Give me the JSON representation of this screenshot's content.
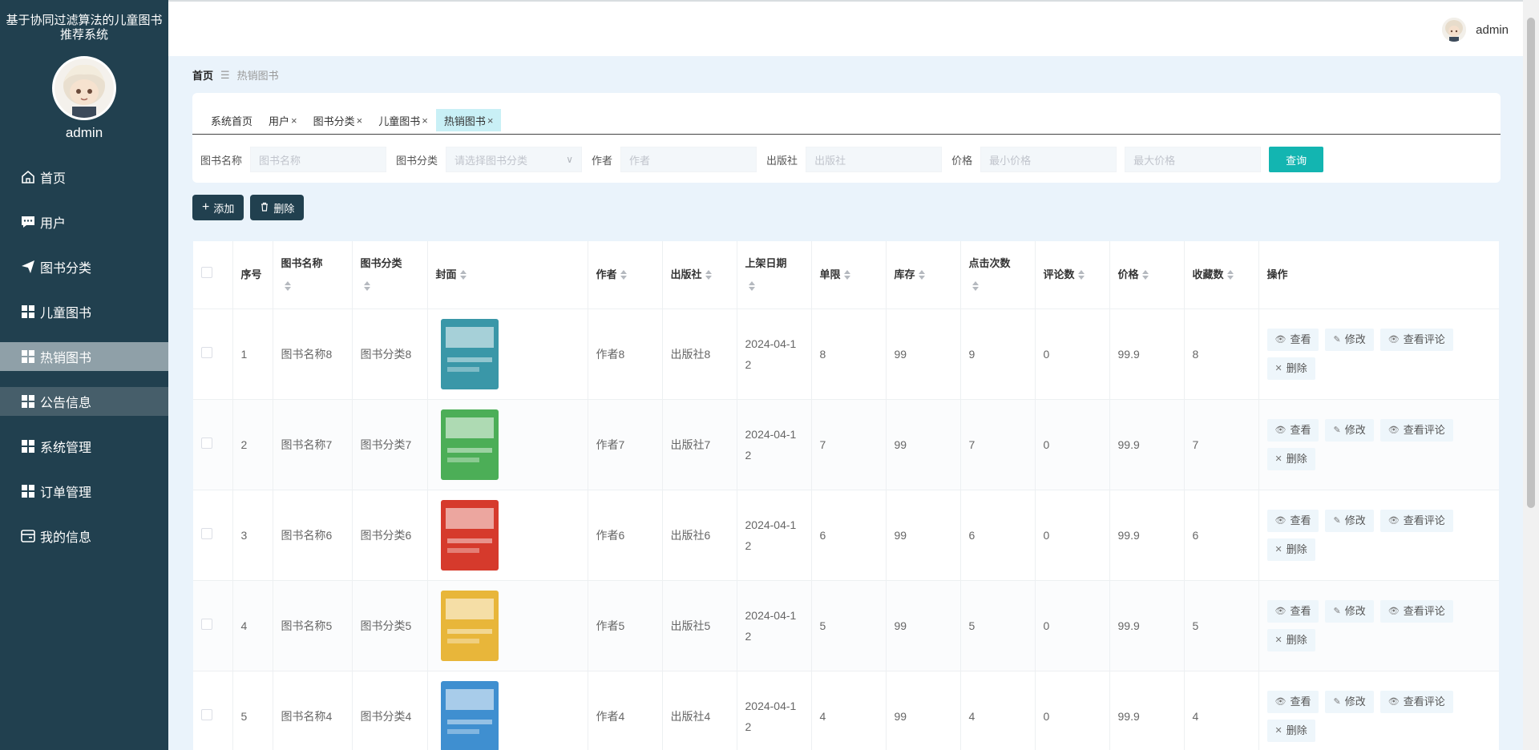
{
  "sidebar": {
    "app_title": "基于协同过滤算法的儿童图书推荐系统",
    "username": "admin",
    "items": [
      {
        "label": "首页",
        "icon": "home-icon"
      },
      {
        "label": "用户",
        "icon": "chat-icon"
      },
      {
        "label": "图书分类",
        "icon": "send-icon"
      },
      {
        "label": "儿童图书",
        "icon": "grid-icon"
      },
      {
        "label": "热销图书",
        "icon": "grid-icon",
        "active": true
      },
      {
        "label": "公告信息",
        "icon": "grid-icon"
      },
      {
        "label": "系统管理",
        "icon": "grid-icon"
      },
      {
        "label": "订单管理",
        "icon": "grid-icon"
      },
      {
        "label": "我的信息",
        "icon": "card-icon"
      }
    ]
  },
  "header": {
    "username": "admin"
  },
  "breadcrumb": {
    "home": "首页",
    "separator": "☰",
    "current": "热销图书"
  },
  "tabs": [
    {
      "label": "系统首页",
      "closable": false
    },
    {
      "label": "用户",
      "closable": true
    },
    {
      "label": "图书分类",
      "closable": true
    },
    {
      "label": "儿童图书",
      "closable": true
    },
    {
      "label": "热销图书",
      "closable": true,
      "active": true
    }
  ],
  "tab_close": "×",
  "search": {
    "name_label": "图书名称",
    "name_placeholder": "图书名称",
    "category_label": "图书分类",
    "category_placeholder": "请选择图书分类",
    "author_label": "作者",
    "author_placeholder": "作者",
    "publisher_label": "出版社",
    "publisher_placeholder": "出版社",
    "price_label": "价格",
    "min_price_placeholder": "最小价格",
    "max_price_placeholder": "最大价格",
    "query_label": "查询"
  },
  "toolbar": {
    "add_label": "添加",
    "delete_label": "删除"
  },
  "table": {
    "columns": [
      "序号",
      "图书名称",
      "图书分类",
      "封面",
      "作者",
      "出版社",
      "上架日期",
      "单限",
      "库存",
      "点击次数",
      "评论数",
      "价格",
      "收藏数",
      "操作"
    ],
    "rows": [
      {
        "index": "1",
        "name": "图书名称8",
        "category": "图书分类8",
        "author": "作者8",
        "publisher": "出版社8",
        "date_line1": "2024-04-1",
        "date_line2": "2",
        "limit": "8",
        "stock": "99",
        "clicks": "9",
        "comments": "0",
        "price": "99.9",
        "favorites": "8",
        "cover_color": "#3a97a8"
      },
      {
        "index": "2",
        "name": "图书名称7",
        "category": "图书分类7",
        "author": "作者7",
        "publisher": "出版社7",
        "date_line1": "2024-04-1",
        "date_line2": "2",
        "limit": "7",
        "stock": "99",
        "clicks": "7",
        "comments": "0",
        "price": "99.9",
        "favorites": "7",
        "cover_color": "#4cae57"
      },
      {
        "index": "3",
        "name": "图书名称6",
        "category": "图书分类6",
        "author": "作者6",
        "publisher": "出版社6",
        "date_line1": "2024-04-1",
        "date_line2": "2",
        "limit": "6",
        "stock": "99",
        "clicks": "6",
        "comments": "0",
        "price": "99.9",
        "favorites": "6",
        "cover_color": "#d63a2c"
      },
      {
        "index": "4",
        "name": "图书名称5",
        "category": "图书分类5",
        "author": "作者5",
        "publisher": "出版社5",
        "date_line1": "2024-04-1",
        "date_line2": "2",
        "limit": "5",
        "stock": "99",
        "clicks": "5",
        "comments": "0",
        "price": "99.9",
        "favorites": "5",
        "cover_color": "#e8b63a"
      },
      {
        "index": "5",
        "name": "图书名称4",
        "category": "图书分类4",
        "author": "作者4",
        "publisher": "出版社4",
        "date_line1": "2024-04-1",
        "date_line2": "2",
        "limit": "4",
        "stock": "99",
        "clicks": "4",
        "comments": "0",
        "price": "99.9",
        "favorites": "4",
        "cover_color": "#3f8fd0"
      }
    ],
    "ops": {
      "view": "查看",
      "edit": "修改",
      "view_comments": "查看评论",
      "delete": "删除"
    }
  },
  "colors": {
    "sidebar_bg": "#21404f",
    "accent": "#13b5b1",
    "active_tab": "#c9f0f6",
    "page_bg": "#eaf3fb"
  }
}
